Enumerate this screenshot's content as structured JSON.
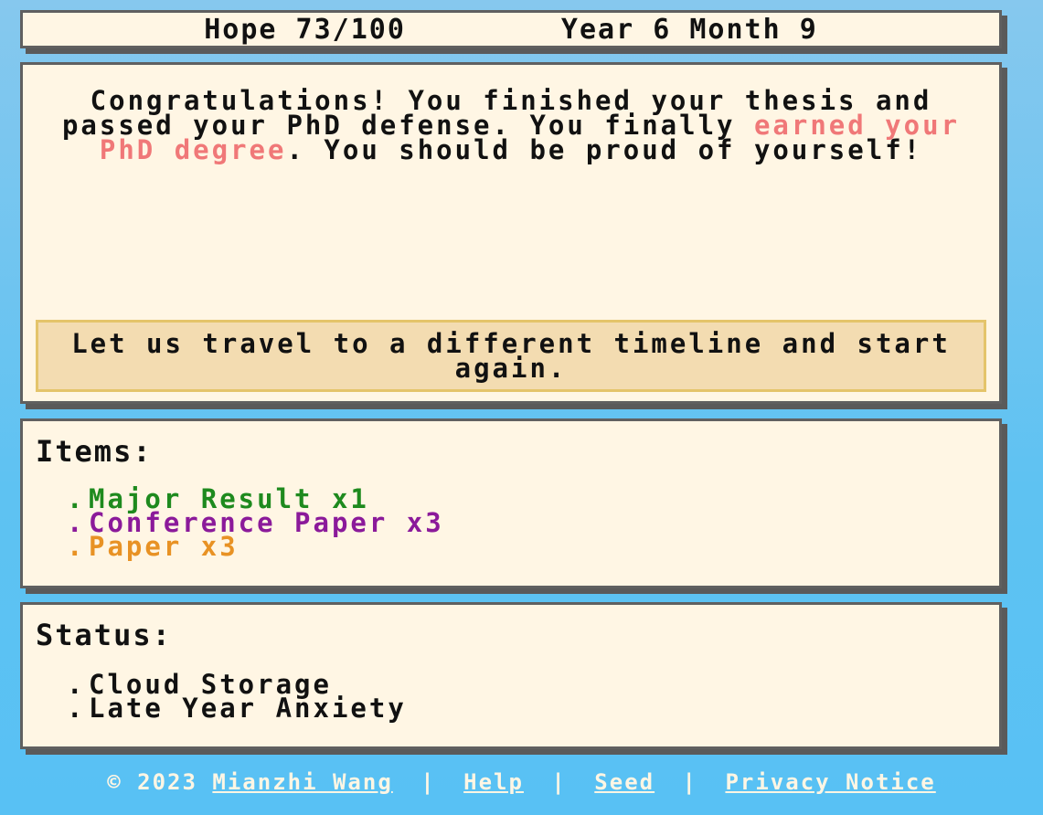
{
  "header": {
    "hope": "Hope 73/100",
    "date": "Year 6 Month 9"
  },
  "story": {
    "text_before": "Congratulations! You finished your thesis and passed your PhD defense. You finally ",
    "highlight": "earned your PhD degree",
    "text_after": ". You should be proud of yourself!",
    "choice": "Let us travel to a different timeline and start again."
  },
  "items": {
    "title": "Items:",
    "list": [
      {
        "bullet": ".",
        "label": "Major Result x1",
        "color": "#1e8a1e"
      },
      {
        "bullet": ".",
        "label": "Conference Paper x3",
        "color": "#8b1a9a"
      },
      {
        "bullet": ".",
        "label": "Paper x3",
        "color": "#e89224"
      }
    ]
  },
  "status": {
    "title": "Status:",
    "list": [
      {
        "bullet": ".",
        "label": "Cloud Storage"
      },
      {
        "bullet": ".",
        "label": "Late Year Anxiety"
      }
    ]
  },
  "footer": {
    "copyright": "© 2023",
    "author": "Mianzhi Wang",
    "sep": "|",
    "help": "Help",
    "seed": "Seed",
    "privacy": "Privacy Notice"
  },
  "colors": {
    "background": "#5ec2f2",
    "panel": "#fff6e4",
    "highlight": "#f07878",
    "choice_bg": "#f3dcb1"
  }
}
